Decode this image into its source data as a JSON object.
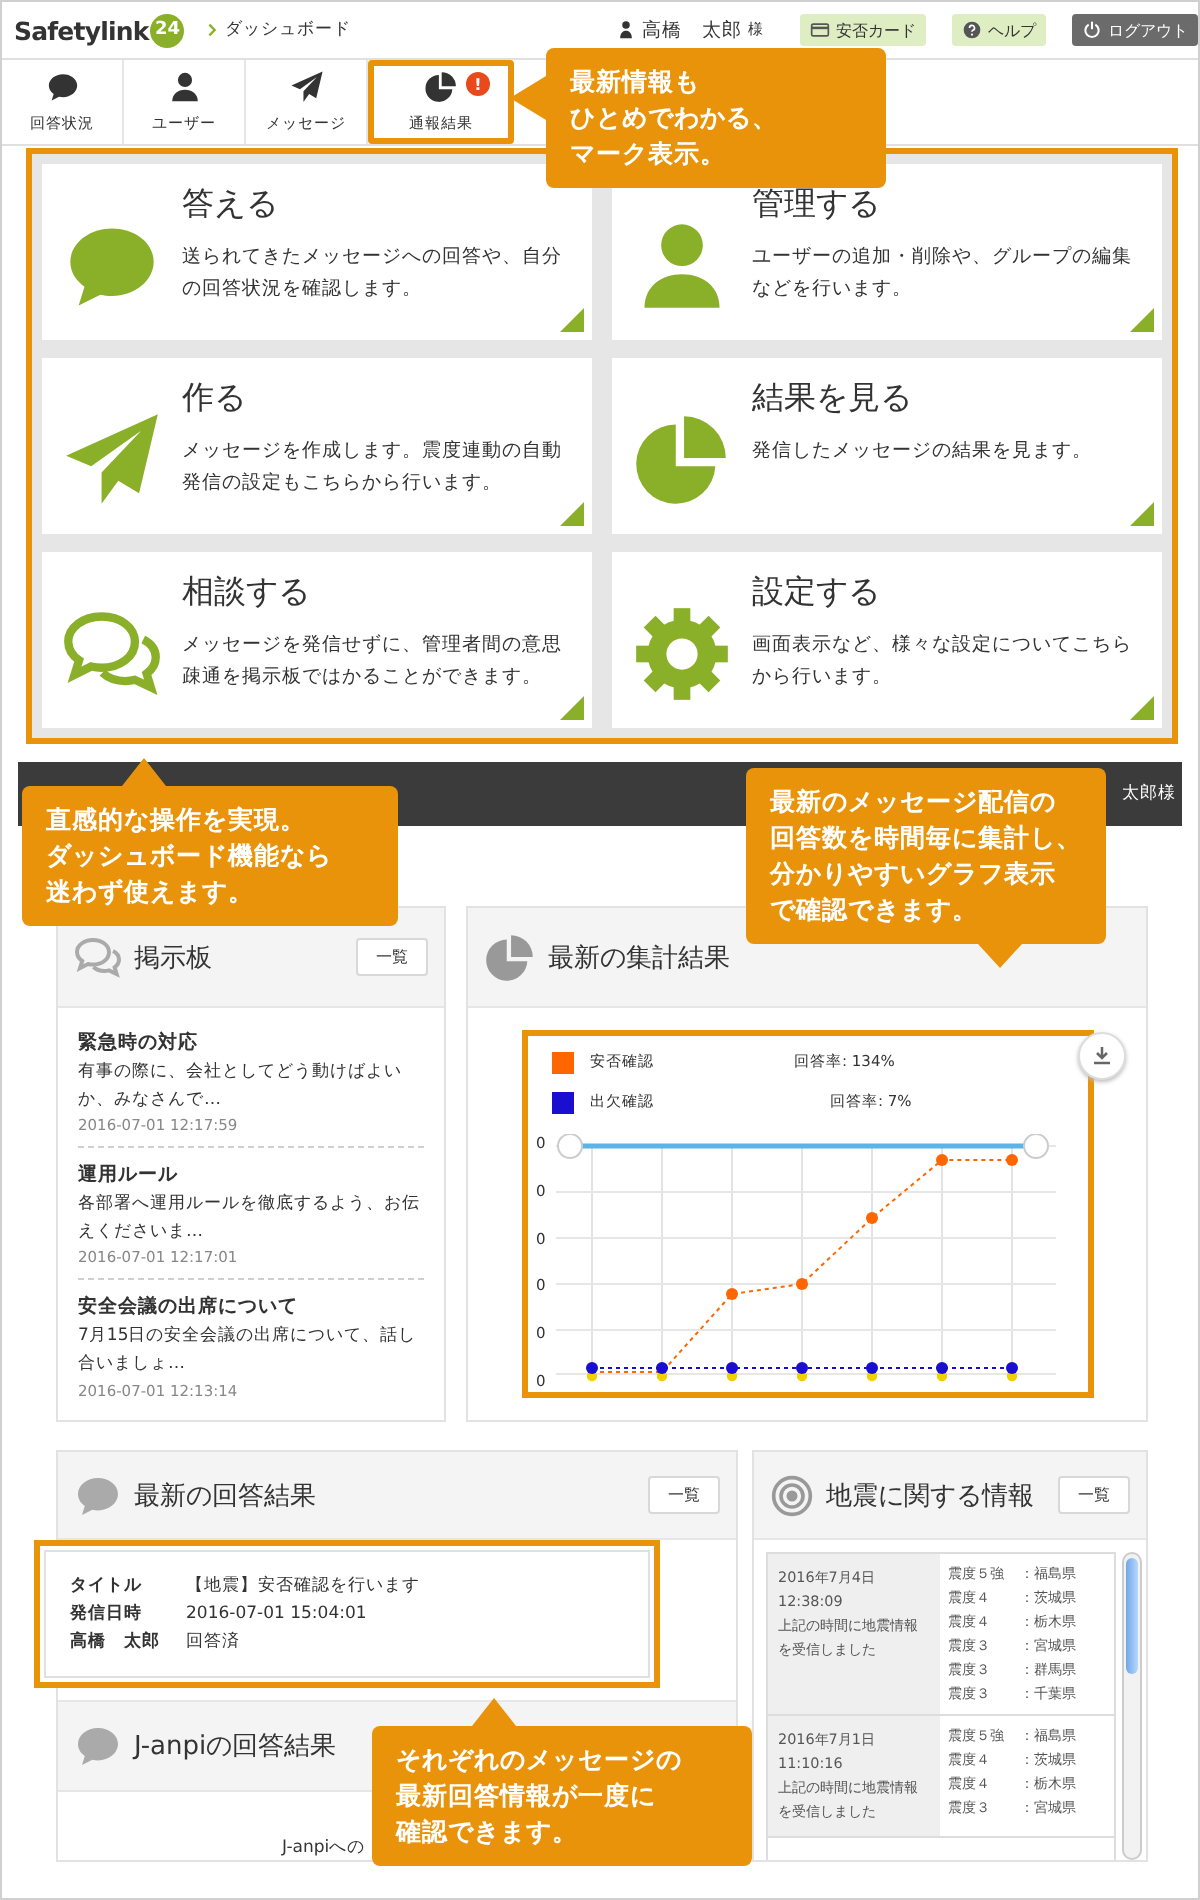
{
  "header": {
    "logo": "Safetylink",
    "logo_badge": "24",
    "breadcrumb": "ダッシュボード",
    "user_name": "高橋　太郎",
    "user_suffix": "様",
    "buttons": [
      {
        "label": "安否カード",
        "kind": "card"
      },
      {
        "label": "ヘルプ",
        "kind": "help"
      },
      {
        "label": "ログアウト",
        "kind": "logout"
      }
    ]
  },
  "nav_tabs": [
    {
      "label": "回答状況",
      "highlighted": false
    },
    {
      "label": "ユーザー",
      "highlighted": false
    },
    {
      "label": "メッセージ",
      "highlighted": false
    },
    {
      "label": "通報結果",
      "highlighted": true,
      "badge": "!"
    }
  ],
  "cards": [
    {
      "title": "答える",
      "description": "送られてきたメッセージへの回答や、自分の回答状況を確認します。"
    },
    {
      "title": "管理する",
      "description": "ユーザーの追加・削除や、グループの編集などを行います。"
    },
    {
      "title": "作る",
      "description": "メッセージを作成します。震度連動の自動発信の設定もこちらから行います。"
    },
    {
      "title": "結果を見る",
      "description": "発信したメッセージの結果を見ます。"
    },
    {
      "title": "相談する",
      "description": "メッセージを発信せずに、管理者間の意思疎通を掲示板ではかることができます。"
    },
    {
      "title": "設定する",
      "description": "画面表示など、様々な設定についてこちらから行います。"
    }
  ],
  "dashboard_bar": {
    "user_name": "太郎様"
  },
  "bulletin": {
    "title": "掲示板",
    "more_button": "一覧",
    "posts": [
      {
        "title": "緊急時の対応",
        "excerpt": "有事の際に、会社としてどう動けばよいか、みなさんで…",
        "date": "2016-07-01 12:17:59"
      },
      {
        "title": "運用ルール",
        "excerpt": "各部署へ運用ルールを徹底するよう、お伝えくださいま…",
        "date": "2016-07-01 12:17:01"
      },
      {
        "title": "安全会議の出席について",
        "excerpt": "7月15日の安全会議の出席について、話し合いましょ…",
        "date": "2016-07-01 12:13:14"
      }
    ]
  },
  "summary": {
    "title": "最新の集計結果",
    "legend": [
      {
        "label": "安否確認",
        "rate": "回答率: 134%",
        "color": "#ff6600"
      },
      {
        "label": "出欠確認",
        "rate": "回答率: 7%",
        "color": "#1a0fd0"
      }
    ],
    "y_tick_labels": [
      "0",
      "0",
      "0",
      "0",
      "0",
      "0"
    ]
  },
  "latest_answers": {
    "title": "最新の回答結果",
    "more_button": "一覧",
    "rows": [
      {
        "label": "タイトル",
        "value": "【地震】安否確認を行います"
      },
      {
        "label": "発信日時",
        "value": "2016-07-01 15:04:01"
      },
      {
        "label": "高橋　太郎",
        "value": "回答済"
      }
    ]
  },
  "janpi": {
    "title": "J-anpiの回答結果",
    "message": "J-anpiへの"
  },
  "earthquake": {
    "title": "地震に関する情報",
    "more_button": "一覧",
    "entries": [
      {
        "date": "2016年7月4日",
        "time": "12:38:09",
        "description": "上記の時間に地震情報を受信しました",
        "intensities": [
          {
            "level": "震度５強",
            "place": "：福島県"
          },
          {
            "level": "震度４",
            "place": "：茨城県"
          },
          {
            "level": "震度４",
            "place": "：栃木県"
          },
          {
            "level": "震度３",
            "place": "：宮城県"
          },
          {
            "level": "震度３",
            "place": "：群馬県"
          },
          {
            "level": "震度３",
            "place": "：千葉県"
          }
        ]
      },
      {
        "date": "2016年7月1日",
        "time": "11:10:16",
        "description": "上記の時間に地震情報を受信しました",
        "intensities": [
          {
            "level": "震度５強",
            "place": "：福島県"
          },
          {
            "level": "震度４",
            "place": "：茨城県"
          },
          {
            "level": "震度４",
            "place": "：栃木県"
          },
          {
            "level": "震度３",
            "place": "：宮城県"
          }
        ]
      }
    ]
  },
  "callouts": [
    {
      "lines": [
        "最新情報も",
        "ひとめでわかる、",
        "マーク表示。"
      ],
      "kind": "left"
    },
    {
      "lines": [
        "直感的な操作を実現。",
        "ダッシュボード機能なら",
        "迷わず使えます。"
      ],
      "kind": "up"
    },
    {
      "lines": [
        "最新のメッセージ配信の",
        "回答数を時間毎に集計し、",
        "分かりやすいグラフ表示",
        "で確認できます。"
      ],
      "kind": "down"
    },
    {
      "lines": [
        "それぞれのメッセージの",
        "最新回答情報が一度に",
        "確認できます。"
      ],
      "kind": "up"
    }
  ]
}
